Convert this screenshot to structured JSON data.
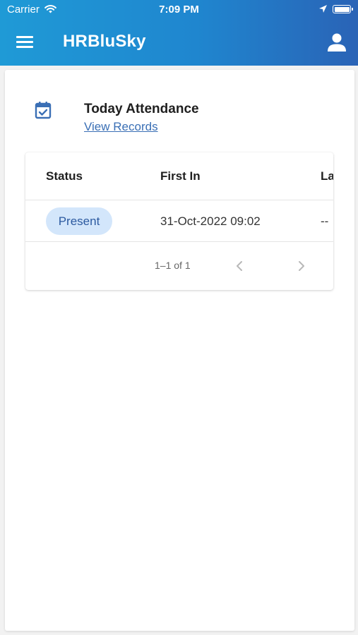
{
  "status_bar": {
    "carrier": "Carrier",
    "time": "7:09 PM"
  },
  "app_bar": {
    "title": "HRBluSky"
  },
  "attendance": {
    "title": "Today Attendance",
    "link_label": "View Records"
  },
  "table": {
    "headers": [
      "Status",
      "First In",
      "La"
    ],
    "rows": [
      {
        "status": "Present",
        "first_in": "31-Oct-2022 09:02",
        "last": "--"
      }
    ],
    "pagination": {
      "range_label": "1–1 of 1"
    }
  },
  "colors": {
    "appbar_gradient_start": "#1f9ad6",
    "appbar_gradient_end": "#2a63b6",
    "link": "#3a6fb5",
    "chip_bg": "#d3e6fb",
    "chip_text": "#2c5aa0",
    "icon_blue": "#3a6fb5"
  },
  "icons": {
    "menu": "hamburger-menu-icon",
    "profile": "user-icon",
    "calendar": "calendar-check-icon",
    "wifi": "wifi-icon",
    "location": "location-arrow-icon",
    "battery": "battery-icon",
    "prev": "chevron-left-icon",
    "next": "chevron-right-icon"
  }
}
